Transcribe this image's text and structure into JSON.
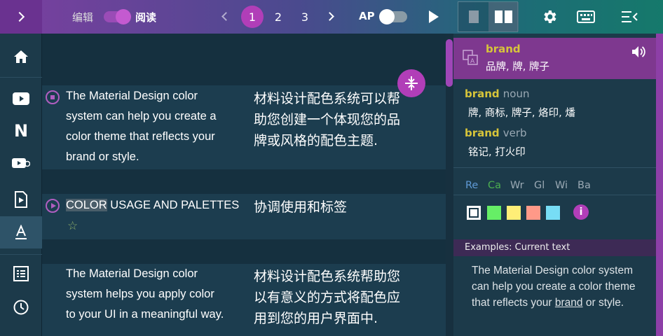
{
  "toolbar": {
    "edit_label": "编辑",
    "read_label": "阅读",
    "pages": [
      "1",
      "2",
      "3"
    ],
    "active_page": "1",
    "ap_label": "AP",
    "colors": {
      "accent": "#b13eb8",
      "word": "#d7c53a"
    }
  },
  "sidebar": {
    "items": [
      {
        "icon": "home-icon"
      },
      {
        "icon": "youtube-icon"
      },
      {
        "icon": "netflix-icon",
        "glyph": "N"
      },
      {
        "icon": "youtube-subtitles-icon"
      },
      {
        "icon": "video-file-icon"
      },
      {
        "icon": "text-format-icon",
        "active": true
      },
      {
        "icon": "list-icon"
      },
      {
        "icon": "history-icon"
      }
    ]
  },
  "main": {
    "rows": [
      {
        "en": [
          "The Material Design color",
          "system can help you create a",
          "color theme that reflects your",
          "brand or style."
        ],
        "zh": [
          "材料设计配色系统可以帮",
          "助您创建一个体现您的品",
          "牌或风格的配色主题."
        ]
      },
      {
        "en_highlight": "COLOR",
        "en_rest": " USAGE AND PALETTES",
        "zh": [
          "协调使用和标签"
        ]
      },
      {
        "en": [
          "The Material Design color",
          "system helps you apply color",
          "to your UI in a meaningful way."
        ],
        "zh": [
          "材料设计配色系统帮助您",
          "以有意义的方式将配色应",
          "用到您的用户界面中."
        ]
      }
    ]
  },
  "panel": {
    "head_word": "brand",
    "head_defs": "品牌, 牌, 牌子",
    "entries": [
      {
        "word": "brand",
        "pos": "noun",
        "defs": "牌, 商标, 牌子, 烙印, 燔"
      },
      {
        "word": "brand",
        "pos": "verb",
        "defs": "铭记, 打火印"
      }
    ],
    "dicts": [
      {
        "label": "Re",
        "color": "#5f9ad6"
      },
      {
        "label": "Ca",
        "color": "#4caf50"
      },
      {
        "label": "Wr",
        "color": "#9aa9b4"
      },
      {
        "label": "Gl",
        "color": "#9aa9b4"
      },
      {
        "label": "Wi",
        "color": "#9aa9b4"
      },
      {
        "label": "Ba",
        "color": "#9aa9b4"
      }
    ],
    "swatches": [
      "#ffffff",
      "#66ee66",
      "#ffee77",
      "#ff9988",
      "#77ddf5"
    ],
    "examples_header": "Examples: Current text",
    "example_before": "The Material Design color system can help you create a color theme that reflects your ",
    "example_word": "brand",
    "example_after": " or style."
  }
}
